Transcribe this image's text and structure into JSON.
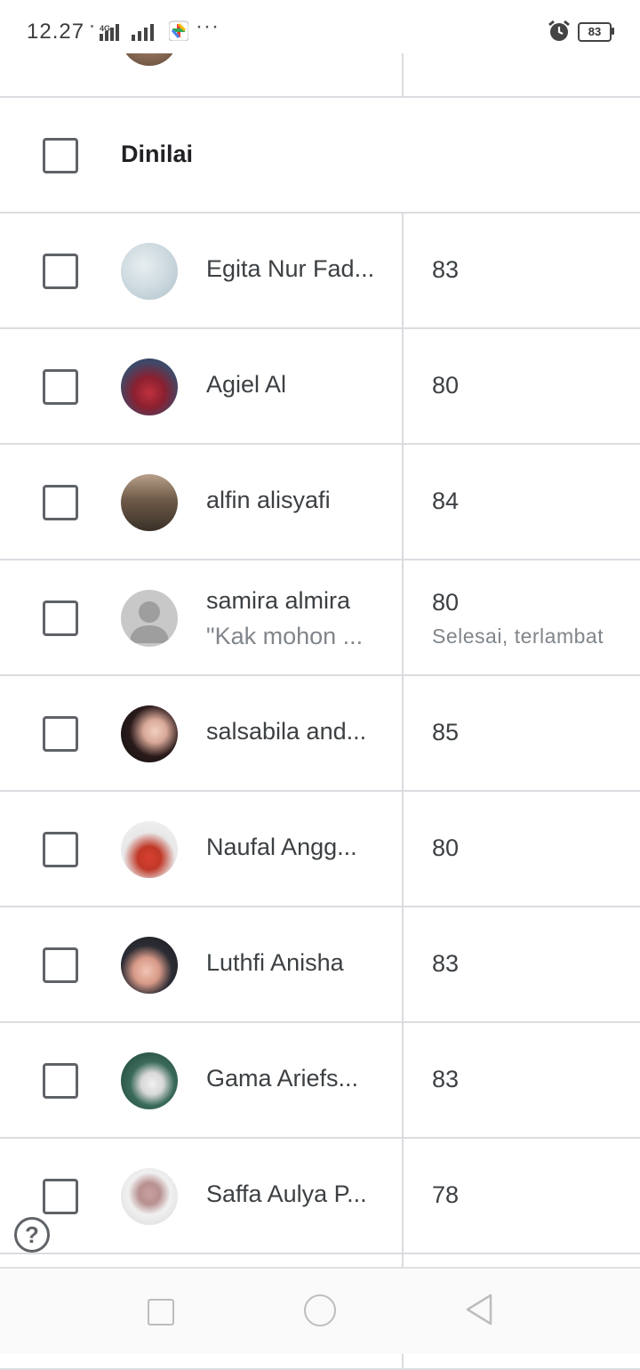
{
  "status_bar": {
    "time": "12.27",
    "network": "4G",
    "dots": "···",
    "battery": "83"
  },
  "section": {
    "title": "Dinilai"
  },
  "students": [
    {
      "name": "Egita Nur Fad...",
      "grade": "83"
    },
    {
      "name": "Agiel Al",
      "grade": "80"
    },
    {
      "name": "alfin alisyafi",
      "grade": "84"
    },
    {
      "name": "samira almira",
      "comment": "\"Kak mohon ...",
      "grade": "80",
      "status": "Selesai, terlambat"
    },
    {
      "name": "salsabila and...",
      "grade": "85"
    },
    {
      "name": "Naufal Angg...",
      "grade": "80"
    },
    {
      "name": "Luthfi Anisha",
      "grade": "83"
    },
    {
      "name": "Gama Ariefs...",
      "grade": "83"
    },
    {
      "name": "Saffa Aulya P...",
      "grade": "78"
    }
  ],
  "help": {
    "label": "?"
  },
  "colors": {
    "divider": "#dadce0",
    "text": "#3c4043",
    "secondary": "#80868b"
  }
}
